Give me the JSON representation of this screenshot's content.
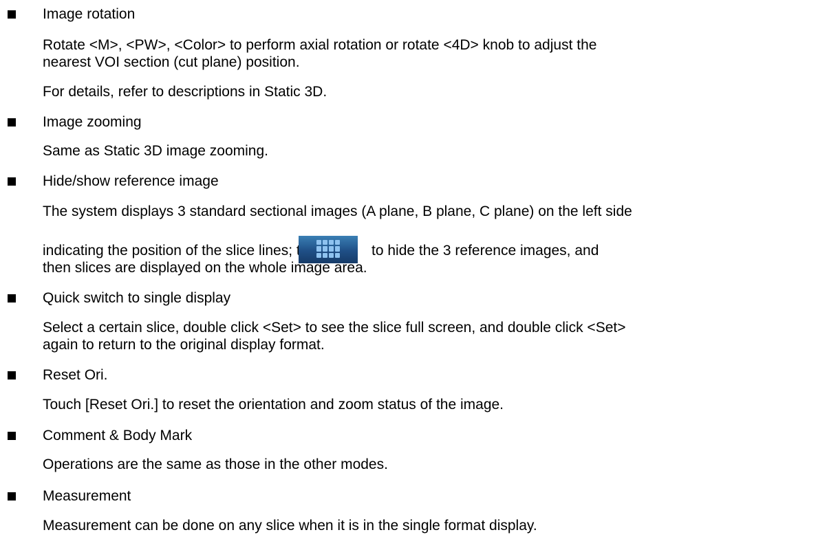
{
  "sections": [
    {
      "heading": "Image rotation",
      "lines": [
        "Rotate <M>, <PW>, <Color> to perform axial rotation or rotate <4D> knob to adjust the",
        "nearest VOI section (cut plane) position.",
        "For details, refer to descriptions in Static 3D."
      ]
    },
    {
      "heading": "Image zooming",
      "lines": [
        "Same as Static 3D image zooming."
      ]
    },
    {
      "heading": "Hide/show reference image",
      "lines": [
        "The system displays 3 standard sectional images (A plane, B plane, C plane) on the left side",
        "indicating the position of the slice lines; touch",
        "to hide the 3 reference images, and",
        "then slices are displayed on the whole image area."
      ]
    },
    {
      "heading": "Quick switch to single display",
      "lines": [
        "Select a certain slice, double click <Set> to see the slice full screen, and double click <Set>",
        "again to return to the original display format."
      ]
    },
    {
      "heading": "Reset Ori.",
      "lines": [
        "Touch [Reset Ori.] to reset the orientation and zoom status of the image."
      ]
    },
    {
      "heading": "Comment & Body Mark",
      "lines": [
        "Operations are the same as those in the other modes."
      ]
    },
    {
      "heading": "Measurement",
      "lines": [
        "Measurement can be done on any slice when it is in the single format display."
      ]
    }
  ],
  "icons": {
    "reference_toggle": "grid-layout-icon"
  }
}
